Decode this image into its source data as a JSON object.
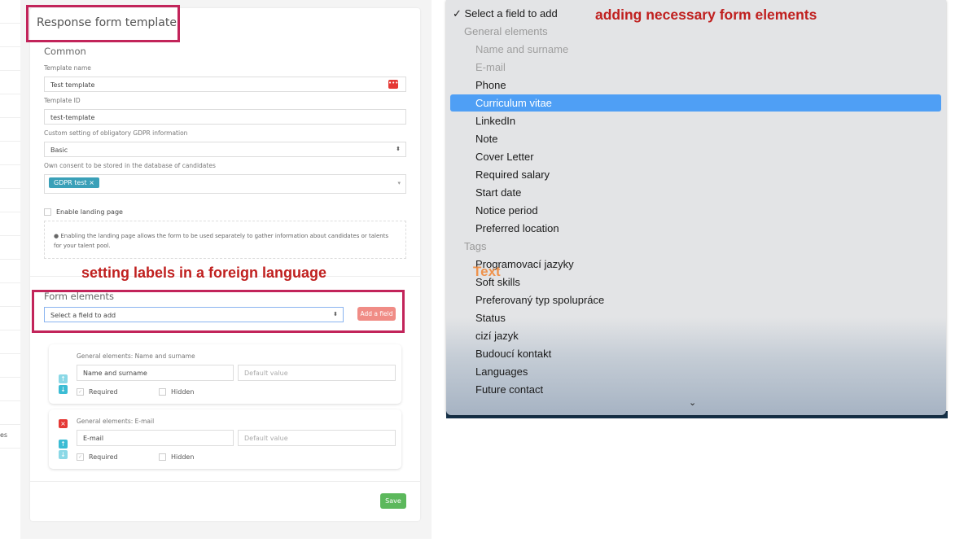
{
  "form": {
    "title": "Response form template",
    "common_heading": "Common",
    "template_name_label": "Template name",
    "template_name_value": "Test template",
    "template_id_label": "Template ID",
    "template_id_value": "test-template",
    "gdpr_label": "Custom setting of obligatory GDPR information",
    "gdpr_value": "Basic",
    "consent_label": "Own consent to be stored in the database of candidates",
    "consent_tag": "GDPR test",
    "landing_label": "Enable landing page",
    "landing_info": "Enabling the landing page allows the form to be used separately to gather information about candidates or talents for your talent pool.",
    "form_elements_heading": "Form elements",
    "select_placeholder": "Select a field to add",
    "add_field_button": "Add a field",
    "elements": [
      {
        "title": "General elements: Name and surname",
        "label_value": "Name and surname",
        "default_placeholder": "Default value",
        "required": "Required",
        "hidden": "Hidden"
      },
      {
        "title": "General elements: E-mail",
        "label_value": "E-mail",
        "default_placeholder": "Default value",
        "required": "Required",
        "hidden": "Hidden"
      }
    ],
    "save_button": "Save",
    "sidebar_fragment": "es"
  },
  "annotations": {
    "left": "setting labels in a foreign language",
    "right": "adding necessary form elements",
    "overlay": "Text"
  },
  "dropdown": {
    "selected": "✓ Select a field to add",
    "groups": [
      {
        "label": "General elements",
        "items": [
          "Name and surname",
          "E-mail",
          "Phone",
          "Curriculum vitae",
          "LinkedIn",
          "Note",
          "Cover Letter",
          "Required salary",
          "Start date",
          "Notice period",
          "Preferred location"
        ]
      },
      {
        "label": "Tags",
        "items": [
          "Programovací jazyky",
          "Soft skills",
          "Preferovaný typ spolupráce",
          "Status",
          "cizí jazyk",
          "Budoucí kontakt",
          "Languages",
          "Future contact"
        ]
      }
    ],
    "highlighted": "Curriculum vitae",
    "disabled": [
      "Name and surname",
      "E-mail"
    ]
  },
  "colors": {
    "highlight": "#4f9ff5",
    "annotation": "#c0201f",
    "save": "#5cb85c",
    "add": "#f08c86"
  }
}
